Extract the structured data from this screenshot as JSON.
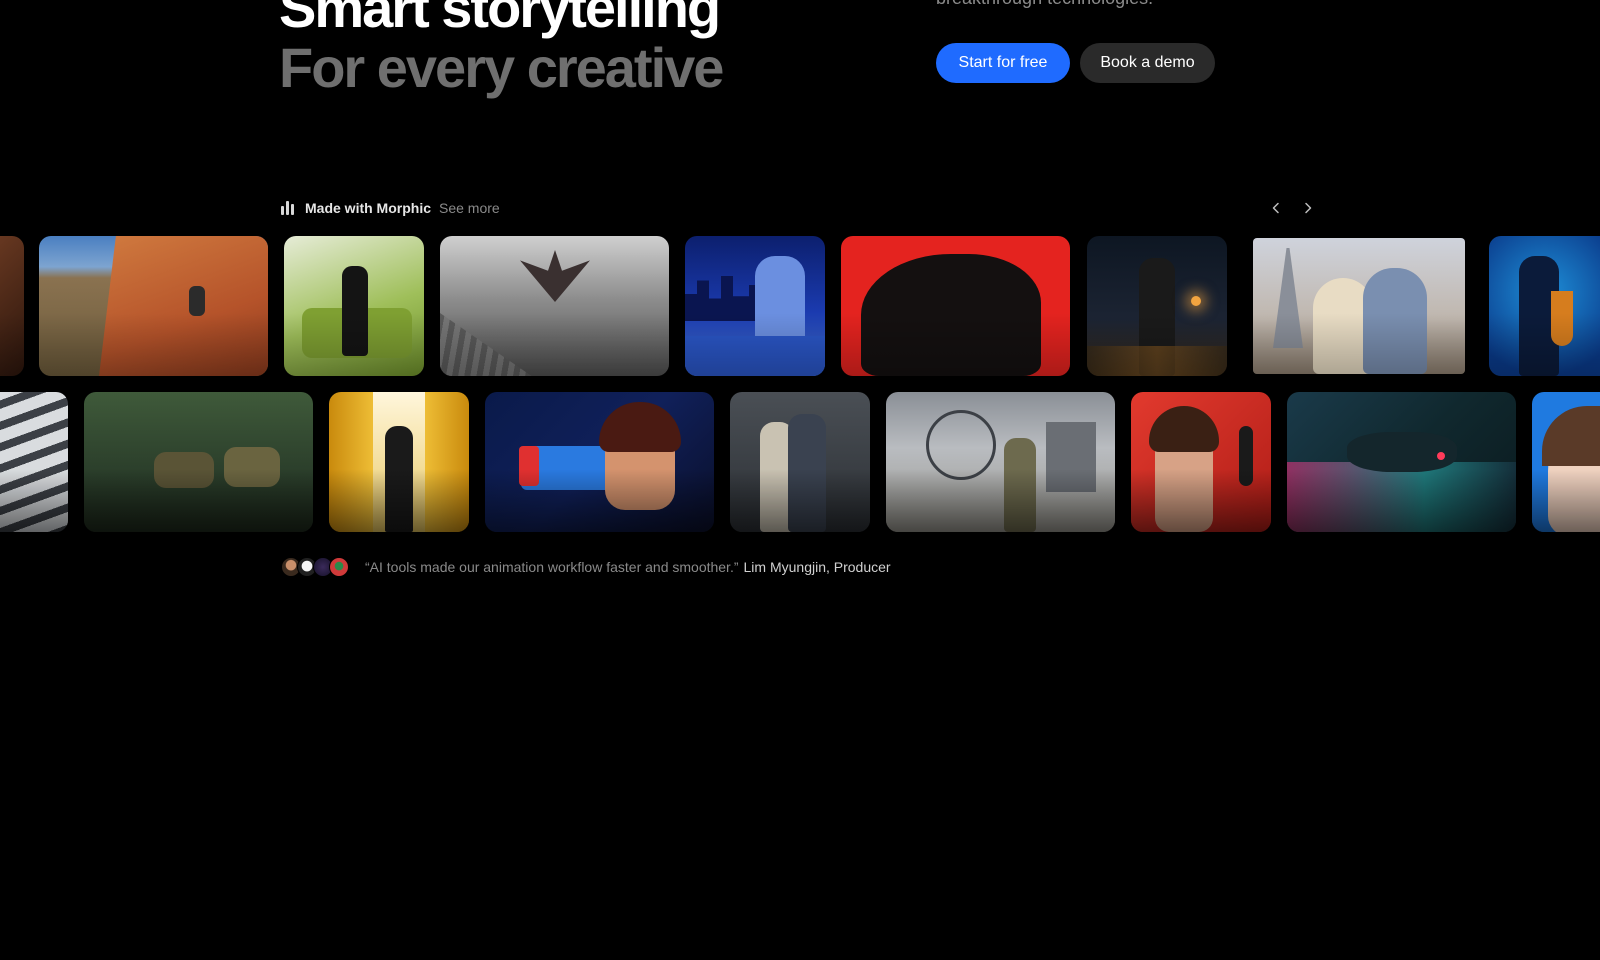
{
  "hero": {
    "title_line1": "Smart storytelling",
    "title_line2": "For every creative",
    "subtitle": "breakthrough technologies.",
    "primary_cta": "Start for free",
    "secondary_cta": "Book a demo"
  },
  "gallery": {
    "icon": "waveform-bars-icon",
    "title": "Made with Morphic",
    "see_more": "See more",
    "prev_icon": "chevron-left-icon",
    "next_icon": "chevron-right-icon",
    "row1": [
      {
        "name": "tile-abstract-rock"
      },
      {
        "name": "tile-rock-climber"
      },
      {
        "name": "tile-woman-green-sofa"
      },
      {
        "name": "tile-dragon-over-roofs"
      },
      {
        "name": "tile-anime-girl-window"
      },
      {
        "name": "tile-black-tiger-red"
      },
      {
        "name": "tile-man-rainy-street"
      },
      {
        "name": "tile-couple-eiffel-tower"
      },
      {
        "name": "tile-saxophone-player"
      }
    ],
    "row2": [
      {
        "name": "tile-building-facade"
      },
      {
        "name": "tile-soldiers-jungle"
      },
      {
        "name": "tile-woman-yellow-hall"
      },
      {
        "name": "tile-woman-red-gun"
      },
      {
        "name": "tile-couple-alley"
      },
      {
        "name": "tile-soldier-ferris-wheel"
      },
      {
        "name": "tile-woman-microphone"
      },
      {
        "name": "tile-neon-spaceships"
      },
      {
        "name": "tile-woman-blue-circle"
      }
    ]
  },
  "testimonial": {
    "quote": "“AI tools made our animation workflow faster and smoother.”",
    "author": "Lim Myungjin, Producer",
    "avatar_count": 4
  }
}
